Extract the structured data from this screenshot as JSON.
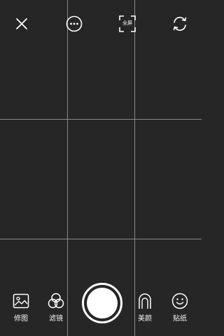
{
  "topbar": {
    "close_icon": "close-icon",
    "more_icon": "more-icon",
    "fullscreen_label": "全屏",
    "switch_camera_icon": "switch-camera-icon"
  },
  "bottombar": {
    "tools": {
      "edit": {
        "label": "修图",
        "icon": "image-edit-icon"
      },
      "filter": {
        "label": "滤镜",
        "icon": "filter-icon"
      },
      "beauty": {
        "label": "美颜",
        "icon": "beauty-icon"
      },
      "sticker": {
        "label": "贴纸",
        "icon": "sticker-icon"
      }
    },
    "shutter_icon": "shutter-icon"
  },
  "colors": {
    "background": "#262626",
    "grid": "#8a8a8a",
    "foreground": "#ffffff"
  }
}
